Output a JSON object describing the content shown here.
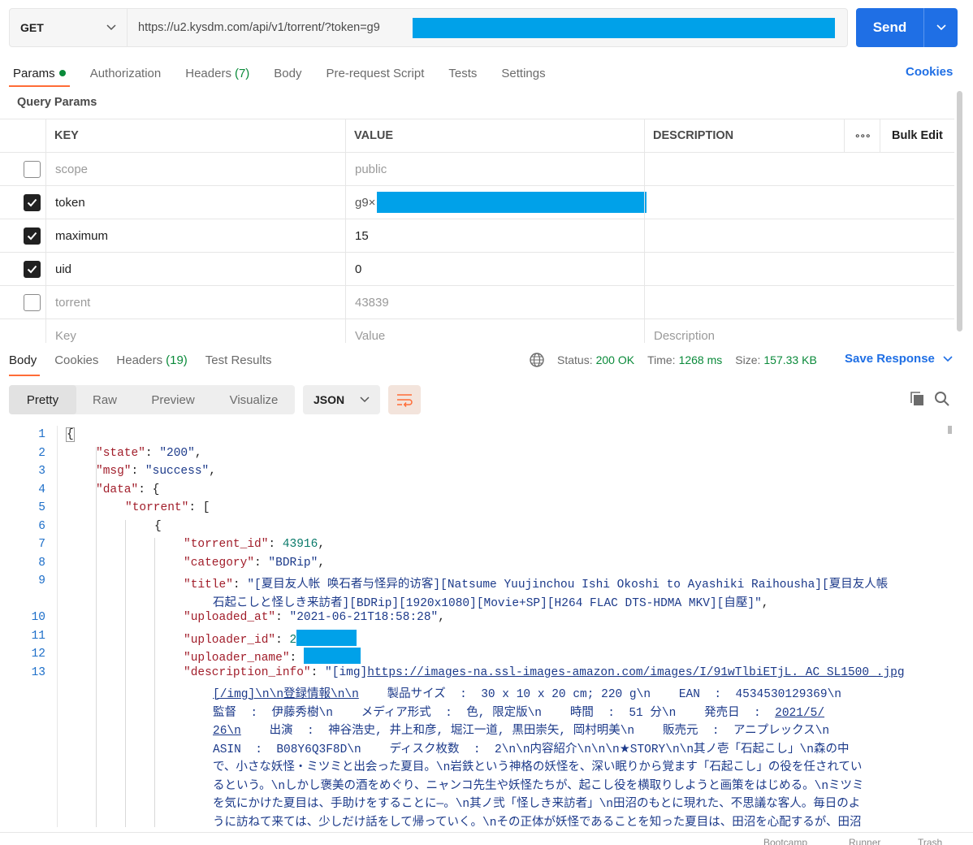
{
  "request": {
    "method": "GET",
    "url_visible": "https://u2.kysdm.com/api/v1/torrent/?token=g9",
    "send_label": "Send"
  },
  "request_tabs": [
    {
      "label": "Params",
      "active": true,
      "dot": true
    },
    {
      "label": "Authorization"
    },
    {
      "label": "Headers",
      "count": "(7)"
    },
    {
      "label": "Body"
    },
    {
      "label": "Pre-request Script"
    },
    {
      "label": "Tests"
    },
    {
      "label": "Settings"
    }
  ],
  "cookies_link": "Cookies",
  "query_params_title": "Query Params",
  "params_table": {
    "headers": {
      "key": "KEY",
      "value": "VALUE",
      "description": "DESCRIPTION",
      "more": "∘∘∘",
      "bulk_edit": "Bulk Edit"
    },
    "rows": [
      {
        "checked": false,
        "key": "scope",
        "value": "public"
      },
      {
        "checked": true,
        "key": "token",
        "value": "g9×"
      },
      {
        "checked": true,
        "key": "maximum",
        "value": "15"
      },
      {
        "checked": true,
        "key": "uid",
        "value": "0"
      },
      {
        "checked": false,
        "key": "torrent",
        "value": "43839"
      }
    ],
    "placeholder": {
      "key": "Key",
      "value": "Value",
      "description": "Description"
    }
  },
  "response_tabs": [
    {
      "label": "Body",
      "active": true
    },
    {
      "label": "Cookies"
    },
    {
      "label": "Headers",
      "count": "(19)"
    },
    {
      "label": "Test Results"
    }
  ],
  "response_status": {
    "status_label": "Status:",
    "status_value": "200 OK",
    "time_label": "Time:",
    "time_value": "1268 ms",
    "size_label": "Size:",
    "size_value": "157.33 KB",
    "save_response": "Save Response"
  },
  "view_modes": [
    "Pretty",
    "Raw",
    "Preview",
    "Visualize"
  ],
  "active_view_mode": "Pretty",
  "format": "JSON",
  "code": {
    "line_numbers": [
      "1",
      "2",
      "3",
      "4",
      "5",
      "6",
      "7",
      "8",
      "9",
      "10",
      "11",
      "12",
      "13"
    ],
    "state_key": "\"state\"",
    "state_val": "\"200\"",
    "msg_key": "\"msg\"",
    "msg_val": "\"success\"",
    "data_key": "\"data\"",
    "torrent_key": "\"torrent\"",
    "torrent_id_key": "\"torrent_id\"",
    "torrent_id_val": "43916",
    "category_key": "\"category\"",
    "category_val": "\"BDRip\"",
    "title_key": "\"title\"",
    "title_val_1": "\"[夏目友人帐 唤石者与怪异的访客][Natsume Yuujinchou Ishi Okoshi to Ayashiki Raihousha][夏目友人帳",
    "title_val_2": "石起こしと怪しき来訪者][BDRip][1920x1080][Movie+SP][H264 FLAC DTS-HDMA MKV][自壓]\"",
    "uploaded_at_key": "\"uploaded_at\"",
    "uploaded_at_val": "\"2021-06-21T18:58:28\"",
    "uploader_id_key": "\"uploader_id\"",
    "uploader_id_val": "2",
    "uploader_name_key": "\"uploader_name\"",
    "description_key": "\"description_info\"",
    "desc_prefix": "\"[img]",
    "desc_link": "https://images-na.ssl-images-amazon.com/images/I/91wTlbiETjL._AC_SL1500_.jpg",
    "desc_l2_link": "[/img]\\n\\n登録情報\\n\\n",
    "desc_l2_rest": "    製品サイズ  :  30 x 10 x 20 cm; 220 g\\n    EAN  :  4534530129369\\n",
    "desc_l3_a": "監督  :  伊藤秀樹\\n    メディア形式  :  色, 限定版\\n    時間  :  51 分\\n    発売日  :  ",
    "desc_l3_link": "2021/5/",
    "desc_l4_link": "26\\n",
    "desc_l4_rest": "    出演  :  神谷浩史, 井上和彦, 堀江一道, 黒田崇矢, 岡村明美\\n    販売元  :  アニプレックス\\n",
    "desc_l5": "ASIN  :  B08Y6Q3F8D\\n    ディスク枚数  :  2\\n\\n内容紹介\\n\\n\\n★STORY\\n\\n其ノ壱「石起こし」\\n森の中",
    "desc_l6": "で、小さな妖怪・ミツミと出会った夏目。\\n岩鉄という神格の妖怪を、深い眠りから覚ます「石起こし」の役を任されてい",
    "desc_l7": "るという。\\nしかし褒美の酒をめぐり、ニャンコ先生や妖怪たちが、起こし役を横取りしようと画策をはじめる。\\nミツミ",
    "desc_l8": "を気にかけた夏目は、手助けをすることに—。\\n其ノ弐「怪しき来訪者」\\n田沼のもとに現れた、不思議な客人。毎日のよ",
    "desc_l9": "うに訪ねて来ては、少しだけ話をして帰っていく。\\nその正体が妖怪であることを知った夏目は、田沼を心配するが、田沼"
  },
  "bottom_bar": {
    "bootcamp": "Bootcamp",
    "runner": "Runner",
    "trash": "Trash"
  },
  "colors": {
    "accent_orange": "#ff6c37",
    "send_blue": "#1f6fe5",
    "status_green": "#0a8a3a",
    "redaction": "#00a1e9"
  }
}
